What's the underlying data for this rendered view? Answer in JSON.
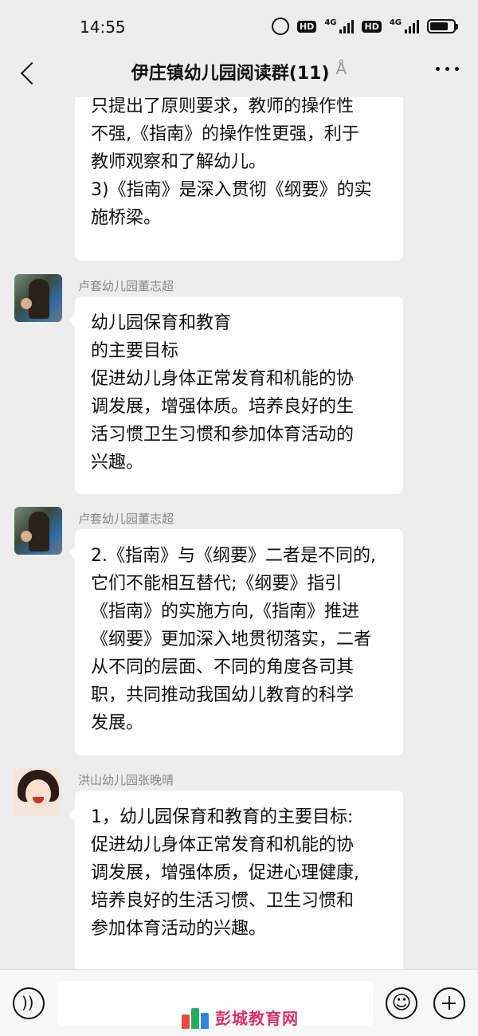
{
  "status_bar": {
    "time": "14:55",
    "hd1": "HD",
    "hd2": "HD",
    "net1": "4G",
    "net2": "4G"
  },
  "header": {
    "title": "伊庄镇幼儿园阅读群(11)",
    "ear_icon": "ear-icon",
    "more_icon": "more-icon"
  },
  "messages": [
    {
      "sender": "",
      "lines": [
        "只提出了原则要求，教师的操作性",
        "不强,《指南》的操作性更强，利于",
        "教师观察和了解幼儿。",
        "3)《指南》是深入贯彻《纲要》的实",
        "施桥梁。"
      ]
    },
    {
      "sender": "卢套幼儿园董志超",
      "lines": [
        "幼儿园保育和教育",
        "的主要目标",
        "促进幼儿身体正常发育和机能的协",
        "调发展，增强体质。培养良好的生",
        "活习惯卫生习惯和参加体育活动的",
        "兴趣。"
      ]
    },
    {
      "sender": "卢套幼儿园董志超",
      "lines": [
        "2.《指南》与《纲要》二者是不同的,",
        "它们不能相互替代;《纲要》指引",
        "《指南》的实施方向,《指南》推进",
        "《纲要》更加深入地贯彻落实，二者",
        "从不同的层面、不同的角度各司其",
        "职，共同推动我国幼儿教育的科学",
        "发展。"
      ]
    },
    {
      "sender": "洪山幼儿园张晚晴",
      "lines": [
        "1，幼儿园保育和教育的主要目标:",
        "促进幼儿身体正常发育和机能的协",
        "调发展，增强体质，促进心理健康,",
        "培养良好的生活习惯、卫生习惯和",
        "参加体育活动的兴趣。"
      ]
    }
  ],
  "input_bar": {
    "voice_icon": "voice-icon",
    "emoji_icon": "emoji-icon",
    "plus_icon": "plus-icon",
    "input_value": ""
  },
  "watermark": {
    "text": "彭城教育网"
  },
  "colors": {
    "background": "#ededed",
    "bubble": "#ffffff",
    "sender": "#888888",
    "watermark": "#d6336c"
  }
}
